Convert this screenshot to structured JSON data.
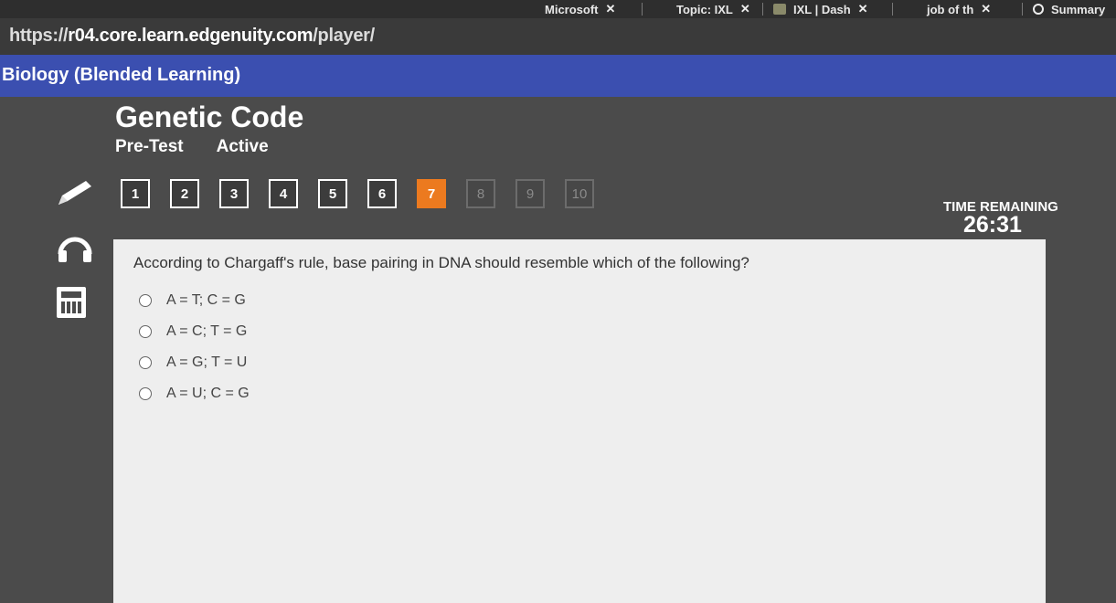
{
  "browser": {
    "tabs": [
      {
        "label": "Microsoft"
      },
      {
        "label": "Topic: IXL"
      },
      {
        "label": "IXL | Dash"
      },
      {
        "label": "job of th"
      },
      {
        "label": "Summary"
      }
    ],
    "url": {
      "prefix": "https://",
      "domain": "r04.core.learn.edgenuity.com",
      "path": "/player/"
    }
  },
  "course": {
    "title": "Biology (Blended Learning)"
  },
  "lesson": {
    "title": "Genetic Code",
    "type": "Pre-Test",
    "status": "Active"
  },
  "tools": [
    "pencil-icon",
    "headphones-icon",
    "calculator-icon"
  ],
  "question_nav": {
    "buttons": [
      "1",
      "2",
      "3",
      "4",
      "5",
      "6",
      "7",
      "8",
      "9",
      "10"
    ],
    "current": "7"
  },
  "timer": {
    "label": "TIME REMAINING",
    "value": "26:31"
  },
  "question": {
    "prompt": "According to Chargaff's rule, base pairing in DNA should resemble which of the following?",
    "choices": [
      "A = T; C = G",
      "A = C; T = G",
      "A = G; T = U",
      "A = U; C = G"
    ]
  },
  "colors": {
    "course_bar": "#3b4fb0",
    "current_question": "#ec7a1f",
    "background": "#4b4b4b",
    "panel": "#eeeeee"
  }
}
